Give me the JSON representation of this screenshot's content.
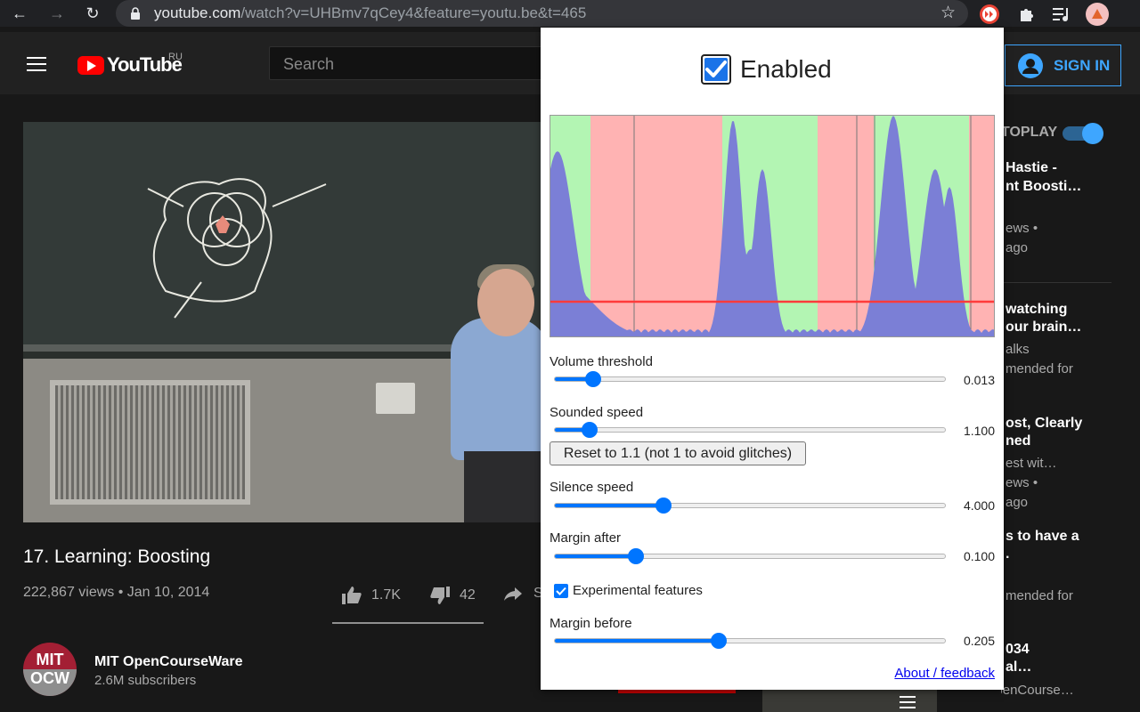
{
  "browser": {
    "url_host": "youtube.com",
    "url_rest": "/watch?v=UHBmv7qCey4&feature=youtu.be&t=465"
  },
  "masthead": {
    "logo_text": "YouTube",
    "region": "RU",
    "search_placeholder": "Search",
    "signin_label": "SIGN IN"
  },
  "video": {
    "title": "17. Learning: Boosting",
    "views_date": "222,867 views • Jan 10, 2014",
    "likes": "1.7K",
    "dislikes": "42",
    "share_partial": "S"
  },
  "channel": {
    "avatar_top": "MIT",
    "avatar_bottom": "OCW",
    "name": "MIT OpenCourseWare",
    "subscribers": "2.6M subscribers"
  },
  "sidebar": {
    "autoplay": "TOPLAY",
    "items": [
      {
        "t1": "Hastie -",
        "t2": "nt Boosti…",
        "m1": "ews •",
        "m2": "ago"
      },
      {
        "t1": "watching",
        "t2": "our brain…",
        "m1": "alks",
        "m2": "mended for"
      },
      {
        "t1": "ost, Clearly",
        "t2": "ned",
        "m1": "est wit…",
        "m2": "ews •",
        "m3": "ago"
      },
      {
        "t1": "s to have a",
        "t2": ".",
        "m1": "mended for"
      },
      {
        "t1": "034",
        "t2": "al…",
        "m1": "MIT OpenCourse…"
      }
    ]
  },
  "popup": {
    "enabled_label": "Enabled",
    "enabled": true,
    "volume_threshold_label": "Volume threshold",
    "volume_threshold": 0.013,
    "volume_threshold_text": "0.013",
    "volume_threshold_fraction": 0.1,
    "sounded_speed_label": "Sounded speed",
    "sounded_speed": 1.1,
    "sounded_speed_text": "1.100",
    "sounded_speed_fraction": 0.09,
    "reset_button": "Reset to 1.1 (not 1 to avoid glitches)",
    "silence_speed_label": "Silence speed",
    "silence_speed": 4.0,
    "silence_speed_text": "4.000",
    "silence_speed_fraction": 0.28,
    "margin_after_label": "Margin after",
    "margin_after": 0.1,
    "margin_after_text": "0.100",
    "margin_after_fraction": 0.21,
    "experimental_label": "Experimental features",
    "experimental": true,
    "margin_before_label": "Margin before",
    "margin_before": 0.205,
    "margin_before_text": "0.205",
    "margin_before_fraction": 0.42,
    "about_link": "About / feedback",
    "colors": {
      "sounded": "#b3f5b3",
      "silence": "#ffb3b3",
      "volume": "#7b7fd6",
      "threshold": "#ff3b3b",
      "accent": "#0075ff"
    }
  }
}
